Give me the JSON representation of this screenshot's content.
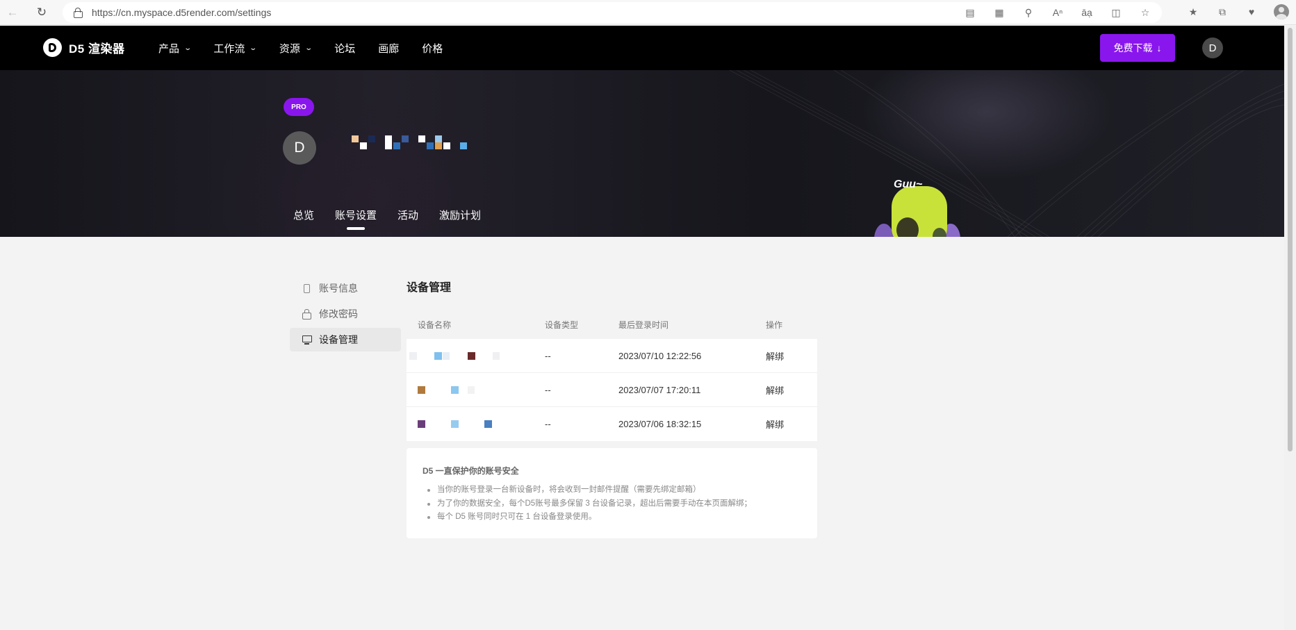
{
  "browser": {
    "url": "https://cn.myspace.d5render.com/settings"
  },
  "header": {
    "logo_text": "D5 渲染器",
    "nav": [
      {
        "label": "产品",
        "dropdown": true
      },
      {
        "label": "工作流",
        "dropdown": true
      },
      {
        "label": "资源",
        "dropdown": true
      },
      {
        "label": "论坛",
        "dropdown": false
      },
      {
        "label": "画廊",
        "dropdown": false
      },
      {
        "label": "价格",
        "dropdown": false
      }
    ],
    "download_label": "免费下载",
    "download_icon": "↓",
    "avatar_letter": "D",
    "accent_color": "#8a16ee"
  },
  "hero": {
    "badge": "PRO",
    "avatar_letter": "D",
    "tabs": [
      "总览",
      "账号设置",
      "活动",
      "激励计划"
    ],
    "active_tab": "账号设置",
    "mascot_text": "Guu~"
  },
  "sidebar": {
    "items": [
      {
        "label": "账号信息",
        "icon": "phone-icon"
      },
      {
        "label": "修改密码",
        "icon": "lock-icon"
      },
      {
        "label": "设备管理",
        "icon": "monitor-icon",
        "active": true
      }
    ]
  },
  "devices": {
    "title": "设备管理",
    "columns": [
      "设备名称",
      "设备类型",
      "最后登录时间",
      "操作"
    ],
    "rows": [
      {
        "type": "--",
        "last_login": "2023/07/10 12:22:56",
        "action": "解绑"
      },
      {
        "type": "--",
        "last_login": "2023/07/07 17:20:11",
        "action": "解绑"
      },
      {
        "type": "--",
        "last_login": "2023/07/06 18:32:15",
        "action": "解绑"
      }
    ]
  },
  "notice": {
    "title": "D5 一直保护你的账号安全",
    "items": [
      "当你的账号登录一台新设备时，将会收到一封邮件提醒（需要先绑定邮箱）",
      "为了你的数据安全，每个D5账号最多保留 3 台设备记录，超出后需要手动在本页面解绑；",
      "每个 D5 账号同时只可在 1 台设备登录使用。"
    ]
  }
}
